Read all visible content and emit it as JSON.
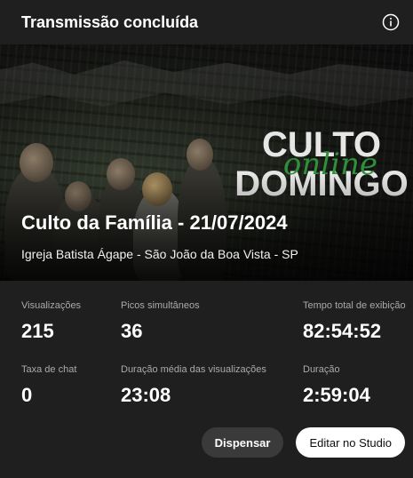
{
  "header": {
    "title": "Transmissão concluída",
    "info_icon": "info-icon"
  },
  "hero": {
    "video_title": "Culto da Família - 21/07/2024",
    "channel": "Igreja Batista Ágape - São João da Boa Vista - SP",
    "logo_line1": "CULTO",
    "logo_script": "online",
    "logo_line2": "DOMINGO",
    "logo_script_color": "#2f8f3a"
  },
  "stats": [
    {
      "label": "Visualizações",
      "value": "215"
    },
    {
      "label": "Picos simultâneos",
      "value": "36"
    },
    {
      "label": "Tempo total de exibição",
      "value": "82:54:52"
    },
    {
      "label": "Taxa de chat",
      "value": "0"
    },
    {
      "label": "Duração média das visualizações",
      "value": "23:08"
    },
    {
      "label": "Duração",
      "value": "2:59:04"
    }
  ],
  "actions": {
    "dismiss_label": "Dispensar",
    "studio_label": "Editar no Studio"
  }
}
